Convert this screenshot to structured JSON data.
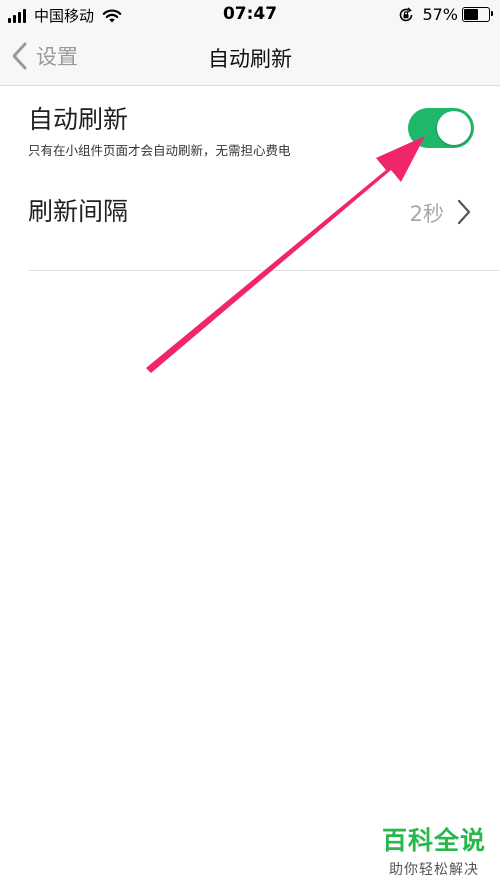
{
  "status_bar": {
    "carrier": "中国移动",
    "time": "07:47",
    "battery_percent": "57%",
    "battery_level": 0.57
  },
  "nav": {
    "back_label": "设置",
    "title": "自动刷新"
  },
  "auto_refresh": {
    "label": "自动刷新",
    "description": "只有在小组件页面才会自动刷新，无需担心费电",
    "enabled": true
  },
  "interval": {
    "label": "刷新间隔",
    "value": "2秒"
  },
  "watermark": {
    "title": "百科全说",
    "subtitle": "助你轻松解决"
  },
  "colors": {
    "toggle_on": "#1fb86a",
    "annotation_arrow": "#f0256a",
    "watermark_green": "#27b74a"
  },
  "icons": {
    "back": "chevron-left-icon",
    "disclosure": "chevron-right-icon",
    "wifi": "wifi-icon",
    "rotation_lock": "rotation-lock-icon"
  }
}
